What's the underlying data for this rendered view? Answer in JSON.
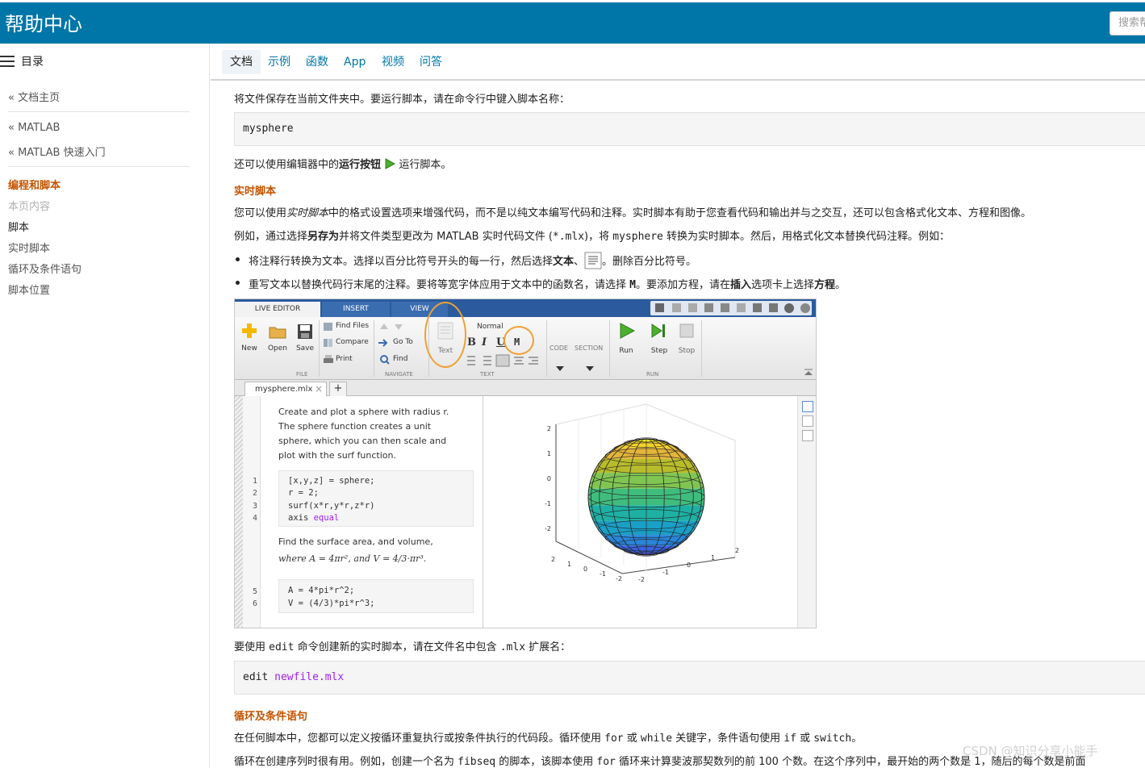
{
  "header": {
    "title": "帮助中心",
    "search_placeholder": "搜索帮"
  },
  "sidebar": {
    "toc_label": "目录",
    "home": "« 文档主页",
    "matlab": "« MATLAB",
    "quick_start": "« MATLAB 快速入门",
    "current": "编程和脚本",
    "on_this_page": "本页内容",
    "items": [
      "脚本",
      "实时脚本",
      "循环及条件语句",
      "脚本位置"
    ]
  },
  "tabs": [
    "文档",
    "示例",
    "函数",
    "App",
    "视频",
    "问答"
  ],
  "content": {
    "p1": "将文件保存在当前文件夹中。要运行脚本，请在命令行中键入脚本名称：",
    "code1": "mysphere",
    "p2a": "还可以使用编辑器中的",
    "p2b": "运行按钮",
    "p2c": "运行脚本。",
    "h_live": "实时脚本",
    "p3a": "您可以使用",
    "p3b": "实时脚本",
    "p3c": "中的格式设置选项来增强代码，而不是以纯文本编写代码和注释。实时脚本有助于您查看代码和输出并与之交互，还可以包含格式化文本、方程和图像。",
    "p4a": "例如，通过选择",
    "p4b": "另存为",
    "p4c": "并将文件类型更改为 MATLAB 实时代码文件 (",
    "p4d": "*.mlx",
    "p4e": ")，将 ",
    "p4f": "mysphere",
    "p4g": " 转换为实时脚本。然后，用格式化文本替换代码注释。例如：",
    "b1a": "将注释行转换为文本。选择以百分比符号开头的每一行，然后选择",
    "b1b": "文本",
    "b1c": "、",
    "b1d": "。删除百分比符号。",
    "b2a": "重写文本以替换代码行末尾的注释。要将等宽字体应用于文本中的函数名，请选择 ",
    "b2b": "M",
    "b2c": "。要添加方程，请在",
    "b2d": "插入",
    "b2e": "选项卡上选择",
    "b2f": "方程",
    "b2g": "。",
    "p5a": "要使用 ",
    "p5b": "edit",
    "p5c": " 命令创建新的实时脚本，请在文件名中包含 ",
    "p5d": ".mlx",
    "p5e": " 扩展名：",
    "code2a": "edit ",
    "code2b": "newfile.mlx",
    "h_loop": "循环及条件语句",
    "p6a": "在任何脚本中，您都可以定义按循环重复执行或按条件执行的代码段。循环使用 ",
    "p6b": "for",
    "p6c": " 或 ",
    "p6d": "while",
    "p6e": " 关键字，条件语句使用 ",
    "p6f": "if",
    "p6g": " 或 ",
    "p6h": "switch",
    "p6i": "。",
    "p7a": "循环在创建序列时很有用。例如，创建一个名为 ",
    "p7b": "fibseq",
    "p7c": " 的脚本，该脚本使用 ",
    "p7d": "for",
    "p7e": " 循环来计算斐波那契数列的前 100 个数。在这个序列中，最开始的两个数是 1，随后的每个数是前面"
  },
  "editor": {
    "tabs": [
      "LIVE EDITOR",
      "INSERT",
      "VIEW"
    ],
    "buttons": {
      "new": "New",
      "open": "Open",
      "save": "Save",
      "find_files": "Find Files",
      "compare": "Compare",
      "print": "Print",
      "go_to": "Go To",
      "find": "Find",
      "text": "Text",
      "normal": "Normal",
      "run": "Run",
      "step": "Step",
      "stop": "Stop",
      "code": "CODE",
      "section": "SECTION",
      "b": "B",
      "i": "I",
      "u": "U",
      "m": "M"
    },
    "groups": [
      "FILE",
      "NAVIGATE",
      "TEXT",
      "RUN"
    ],
    "file_tab": "mysphere.mlx",
    "plus": "+",
    "close": "×",
    "text1": [
      "Create and plot a sphere with radius r.",
      "The sphere function creates a unit",
      "sphere, which you can then scale and",
      "plot with the surf function."
    ],
    "code1": [
      "[x,y,z] = sphere;",
      "r = 2;",
      "surf(x*r,y*r,z*r)",
      "axis "
    ],
    "code1_str": "equal",
    "text2": [
      "Find the surface area, and volume,",
      "where A = 4πr², and V = 4/3·πr³."
    ],
    "code2": [
      "A = 4*pi*r^2;",
      "V = (4/3)*pi*r^3;"
    ],
    "line_numbers": [
      "1",
      "2",
      "3",
      "4",
      "5",
      "6"
    ],
    "zticks": [
      "2",
      "1",
      "0",
      "-1",
      "-2"
    ],
    "xticks": [
      "2",
      "1",
      "0",
      "-1",
      "-2"
    ],
    "yticks": [
      "-2",
      "-1",
      "0",
      "1",
      "2"
    ]
  },
  "watermark": "CSDN @知识分享小能手"
}
